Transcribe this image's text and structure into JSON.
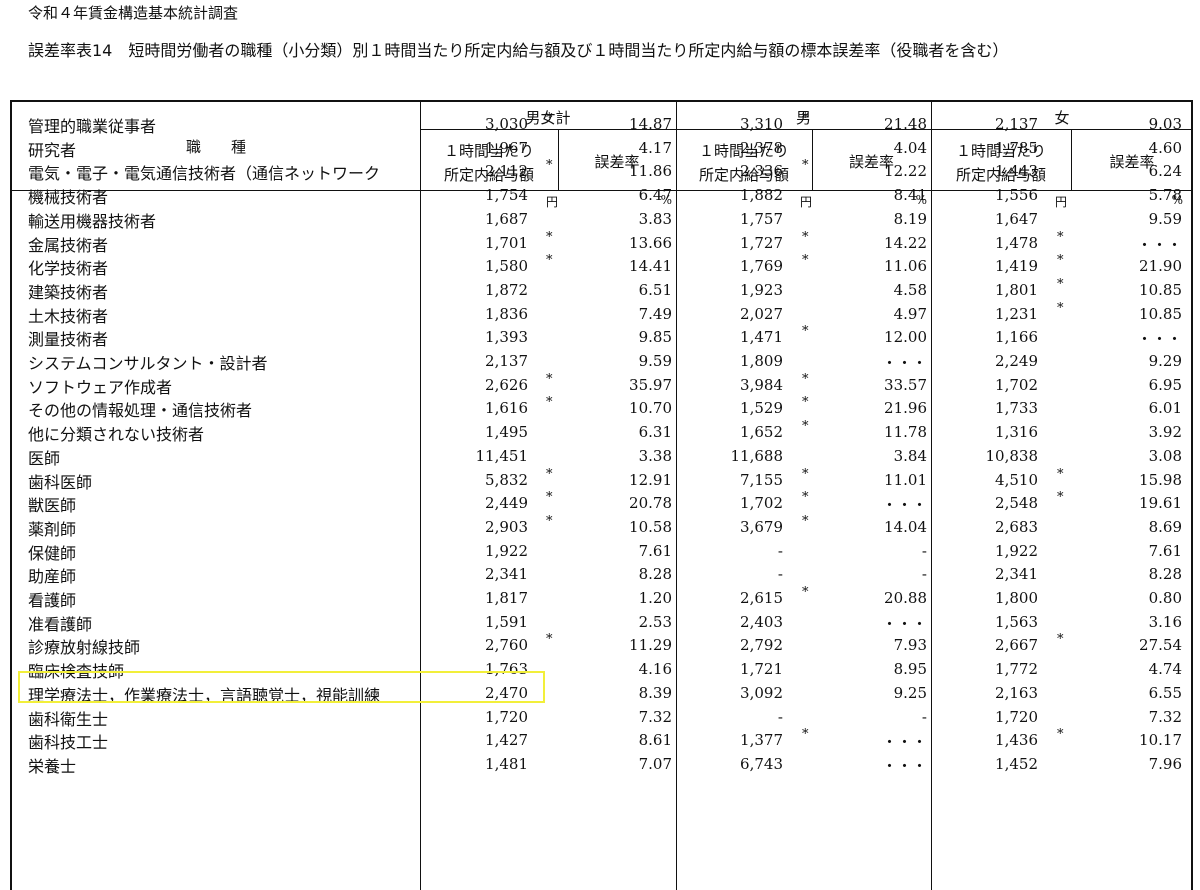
{
  "survey_title": "令和４年賃金構造基本統計調査",
  "table_title": "誤差率表14　短時間労働者の職種（小分類）別１時間当たり所定内給与額及び１時間当たり所定内給与額の標本誤差率（役職者を含む）",
  "header": {
    "occupation": "職　　種",
    "groups": [
      "男女計",
      "男",
      "女"
    ],
    "col_pay": [
      "１時間当たり",
      "所定内給与額"
    ],
    "col_err": "誤差率",
    "unit_pay": "円",
    "unit_err": "%"
  },
  "rows": [
    {
      "name": "管理的職業従事者",
      "t": "3,030",
      "ts": "*",
      "te": "14.87",
      "m": "3,310",
      "ms": "*",
      "me": "21.48",
      "f": "2,137",
      "fs": "",
      "fe": "9.03"
    },
    {
      "name": "研究者",
      "t": "1,967",
      "ts": "",
      "te": "4.17",
      "m": "2,378",
      "ms": "",
      "me": "4.04",
      "f": "1,785",
      "fs": "",
      "fe": "4.60"
    },
    {
      "name": "電気・電子・電気通信技術者（通信ネットワーク",
      "t": "2,112",
      "ts": "*",
      "te": "11.86",
      "m": "2,336",
      "ms": "*",
      "me": "12.22",
      "f": "1,443",
      "fs": "",
      "fe": "6.24"
    },
    {
      "name": "機械技術者",
      "t": "1,754",
      "ts": "",
      "te": "6.47",
      "m": "1,882",
      "ms": "",
      "me": "8.41",
      "f": "1,556",
      "fs": "",
      "fe": "5.78"
    },
    {
      "name": "輸送用機器技術者",
      "t": "1,687",
      "ts": "",
      "te": "3.83",
      "m": "1,757",
      "ms": "",
      "me": "8.19",
      "f": "1,647",
      "fs": "",
      "fe": "9.59"
    },
    {
      "name": "金属技術者",
      "t": "1,701",
      "ts": "*",
      "te": "13.66",
      "m": "1,727",
      "ms": "*",
      "me": "14.22",
      "f": "1,478",
      "fs": "*",
      "fe": "・・・"
    },
    {
      "name": "化学技術者",
      "t": "1,580",
      "ts": "*",
      "te": "14.41",
      "m": "1,769",
      "ms": "*",
      "me": "11.06",
      "f": "1,419",
      "fs": "*",
      "fe": "21.90"
    },
    {
      "name": "建築技術者",
      "t": "1,872",
      "ts": "",
      "te": "6.51",
      "m": "1,923",
      "ms": "",
      "me": "4.58",
      "f": "1,801",
      "fs": "*",
      "fe": "10.85"
    },
    {
      "name": "土木技術者",
      "t": "1,836",
      "ts": "",
      "te": "7.49",
      "m": "2,027",
      "ms": "",
      "me": "4.97",
      "f": "1,231",
      "fs": "*",
      "fe": "10.85"
    },
    {
      "name": "測量技術者",
      "t": "1,393",
      "ts": "",
      "te": "9.85",
      "m": "1,471",
      "ms": "*",
      "me": "12.00",
      "f": "1,166",
      "fs": "",
      "fe": "・・・"
    },
    {
      "name": "システムコンサルタント・設計者",
      "t": "2,137",
      "ts": "",
      "te": "9.59",
      "m": "1,809",
      "ms": "",
      "me": "・・・",
      "f": "2,249",
      "fs": "",
      "fe": "9.29"
    },
    {
      "name": "ソフトウェア作成者",
      "t": "2,626",
      "ts": "*",
      "te": "35.97",
      "m": "3,984",
      "ms": "*",
      "me": "33.57",
      "f": "1,702",
      "fs": "",
      "fe": "6.95"
    },
    {
      "name": "その他の情報処理・通信技術者",
      "t": "1,616",
      "ts": "*",
      "te": "10.70",
      "m": "1,529",
      "ms": "*",
      "me": "21.96",
      "f": "1,733",
      "fs": "",
      "fe": "6.01"
    },
    {
      "name": "他に分類されない技術者",
      "t": "1,495",
      "ts": "",
      "te": "6.31",
      "m": "1,652",
      "ms": "*",
      "me": "11.78",
      "f": "1,316",
      "fs": "",
      "fe": "3.92"
    },
    {
      "name": "医師",
      "t": "11,451",
      "ts": "",
      "te": "3.38",
      "m": "11,688",
      "ms": "",
      "me": "3.84",
      "f": "10,838",
      "fs": "",
      "fe": "3.08"
    },
    {
      "name": "歯科医師",
      "t": "5,832",
      "ts": "*",
      "te": "12.91",
      "m": "7,155",
      "ms": "*",
      "me": "11.01",
      "f": "4,510",
      "fs": "*",
      "fe": "15.98"
    },
    {
      "name": "獣医師",
      "t": "2,449",
      "ts": "*",
      "te": "20.78",
      "m": "1,702",
      "ms": "*",
      "me": "・・・",
      "f": "2,548",
      "fs": "*",
      "fe": "19.61"
    },
    {
      "name": "薬剤師",
      "t": "2,903",
      "ts": "*",
      "te": "10.58",
      "m": "3,679",
      "ms": "*",
      "me": "14.04",
      "f": "2,683",
      "fs": "",
      "fe": "8.69"
    },
    {
      "name": "保健師",
      "t": "1,922",
      "ts": "",
      "te": "7.61",
      "m": "-",
      "ms": "",
      "me": "-",
      "f": "1,922",
      "fs": "",
      "fe": "7.61"
    },
    {
      "name": "助産師",
      "t": "2,341",
      "ts": "",
      "te": "8.28",
      "m": "-",
      "ms": "",
      "me": "-",
      "f": "2,341",
      "fs": "",
      "fe": "8.28"
    },
    {
      "name": "看護師",
      "t": "1,817",
      "ts": "",
      "te": "1.20",
      "m": "2,615",
      "ms": "*",
      "me": "20.88",
      "f": "1,800",
      "fs": "",
      "fe": "0.80"
    },
    {
      "name": "准看護師",
      "t": "1,591",
      "ts": "",
      "te": "2.53",
      "m": "2,403",
      "ms": "",
      "me": "・・・",
      "f": "1,563",
      "fs": "",
      "fe": "3.16"
    },
    {
      "name": "診療放射線技師",
      "t": "2,760",
      "ts": "*",
      "te": "11.29",
      "m": "2,792",
      "ms": "",
      "me": "7.93",
      "f": "2,667",
      "fs": "*",
      "fe": "27.54"
    },
    {
      "name": "臨床検査技師",
      "t": "1,763",
      "ts": "",
      "te": "4.16",
      "m": "1,721",
      "ms": "",
      "me": "8.95",
      "f": "1,772",
      "fs": "",
      "fe": "4.74"
    },
    {
      "name": "理学療法士，作業療法士，言語聴覚士，視能訓練",
      "t": "2,470",
      "ts": "",
      "te": "8.39",
      "m": "3,092",
      "ms": "",
      "me": "9.25",
      "f": "2,163",
      "fs": "",
      "fe": "6.55"
    },
    {
      "name": "歯科衛生士",
      "t": "1,720",
      "ts": "",
      "te": "7.32",
      "m": "-",
      "ms": "",
      "me": "-",
      "f": "1,720",
      "fs": "",
      "fe": "7.32"
    },
    {
      "name": "歯科技工士",
      "t": "1,427",
      "ts": "",
      "te": "8.61",
      "m": "1,377",
      "ms": "*",
      "me": "・・・",
      "f": "1,436",
      "fs": "*",
      "fe": "10.17"
    },
    {
      "name": "栄養士",
      "t": "1,481",
      "ts": "",
      "te": "7.07",
      "m": "6,743",
      "ms": "",
      "me": "・・・",
      "f": "1,452",
      "fs": "",
      "fe": "7.96"
    }
  ],
  "highlight_color": "#f2ef3a"
}
